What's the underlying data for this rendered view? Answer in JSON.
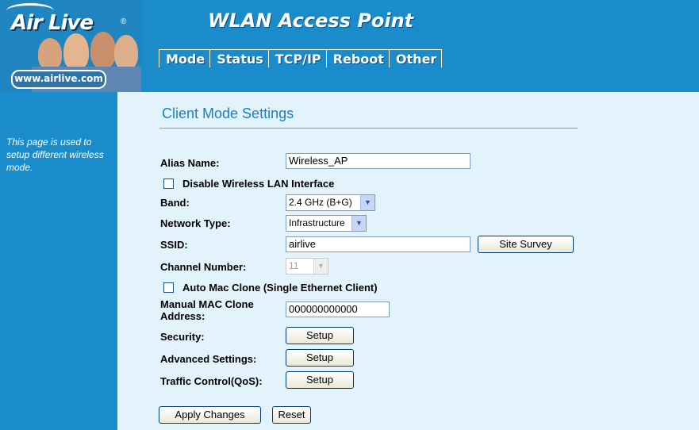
{
  "header": {
    "logo_text": "Air Live",
    "logo_reg": "®",
    "url_badge": "www.airlive.com",
    "title": "WLAN Access Point",
    "nav": [
      "Mode",
      "Status",
      "TCP/IP",
      "Reboot",
      "Other"
    ]
  },
  "sidebar": {
    "help_text": "This page is used to setup different wireless mode."
  },
  "page": {
    "title": "Client Mode Settings"
  },
  "form": {
    "alias_label": "Alias Name:",
    "alias_value": "Wireless_AP",
    "disable_wlan_label": "Disable Wireless LAN Interface",
    "disable_wlan_checked": false,
    "band_label": "Band:",
    "band_value": "2.4 GHz (B+G)",
    "network_type_label": "Network Type:",
    "network_type_value": "Infrastructure",
    "ssid_label": "SSID:",
    "ssid_value": "airlive",
    "site_survey_button": "Site Survey",
    "channel_label": "Channel Number:",
    "channel_value": "11",
    "auto_mac_label": "Auto Mac Clone (Single Ethernet Client)",
    "auto_mac_checked": false,
    "manual_mac_label": "Manual MAC Clone Address:",
    "manual_mac_value": "000000000000",
    "security_label": "Security:",
    "security_button": "Setup",
    "advanced_label": "Advanced Settings:",
    "advanced_button": "Setup",
    "traffic_label": "Traffic Control(QoS):",
    "traffic_button": "Setup",
    "apply_button": "Apply Changes",
    "reset_button": "Reset"
  }
}
